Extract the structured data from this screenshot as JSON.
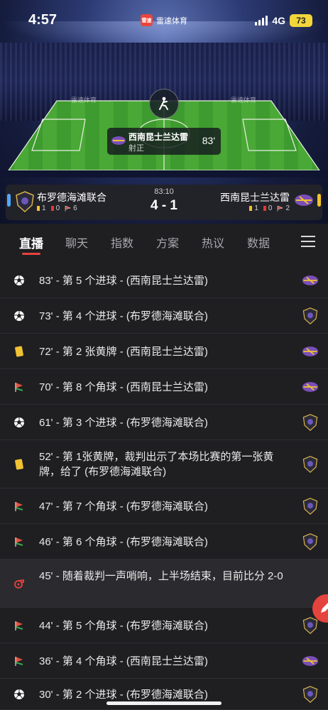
{
  "status_bar": {
    "time": "4:57",
    "app_name": "雷速体育",
    "app_logo_text": "雷速",
    "network": "4G",
    "battery": "73"
  },
  "pitch": {
    "ad_board": "雷速体育",
    "event_team": "西南昆士兰达雷",
    "event_type": "射正",
    "event_minute": "83'"
  },
  "match": {
    "clock": "83:10",
    "score": "4 - 1",
    "home": {
      "name": "布罗德海滩联合",
      "yellow": "1",
      "red": "0",
      "corners": "6"
    },
    "away": {
      "name": "西南昆士兰达雷",
      "yellow": "1",
      "red": "0",
      "corners": "2"
    }
  },
  "tabs": [
    "直播",
    "聊天",
    "指数",
    "方案",
    "热议",
    "数据"
  ],
  "colors": {
    "accent": "#e5433d",
    "yellow_card": "#f1c232",
    "red_card": "#e53935",
    "home_pill": "#4ea9ff",
    "away_pill": "#f1c232"
  },
  "events": [
    {
      "icon": "ball-icon",
      "text": "83' - 第 5 个进球 - (西南昆士兰达雷)",
      "team": "away"
    },
    {
      "icon": "ball-icon",
      "text": "73' - 第 4 个进球 - (布罗德海滩联合)",
      "team": "home"
    },
    {
      "icon": "yellow-card-icon",
      "text": "72' - 第 2 张黄牌 - (西南昆士兰达雷)",
      "team": "away"
    },
    {
      "icon": "corner-flag-icon",
      "text": "70' - 第 8 个角球 - (西南昆士兰达雷)",
      "team": "away"
    },
    {
      "icon": "ball-icon",
      "text": "61' - 第 3 个进球 - (布罗德海滩联合)",
      "team": "home"
    },
    {
      "icon": "yellow-card-icon",
      "text": "52' - 第 1张黄牌，裁判出示了本场比赛的第一张黄牌，给了 (布罗德海滩联合)",
      "team": "home"
    },
    {
      "icon": "corner-flag-icon",
      "text": "47' - 第 7 个角球 - (布罗德海滩联合)",
      "team": "home"
    },
    {
      "icon": "corner-flag-icon",
      "text": "46' - 第 6 个角球 - (布罗德海滩联合)",
      "team": "home"
    },
    {
      "icon": "whistle-icon",
      "text": "45' - 随着裁判一声哨响，上半场结束，目前比分 2-0",
      "team": ""
    },
    {
      "icon": "corner-flag-icon",
      "text": "44' - 第 5 个角球 - (布罗德海滩联合)",
      "team": "home"
    },
    {
      "icon": "corner-flag-icon",
      "text": "36' - 第 4 个角球 - (西南昆士兰达雷)",
      "team": "away"
    },
    {
      "icon": "ball-icon",
      "text": "30' - 第 2 个进球 - (布罗德海滩联合)",
      "team": "home"
    }
  ]
}
